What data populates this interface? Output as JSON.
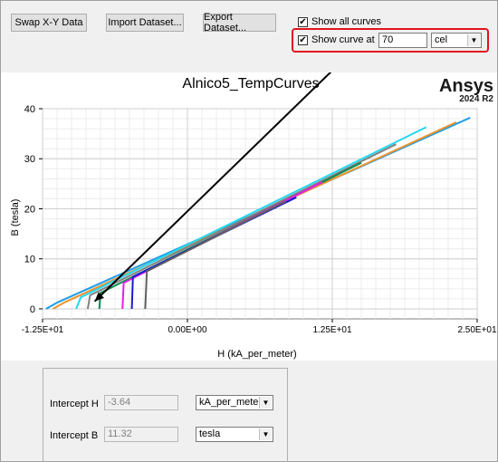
{
  "toolbar": {
    "swap_label": "Swap X-Y Data",
    "import_label": "Import Dataset...",
    "export_label": "Export Dataset..."
  },
  "options": {
    "show_all_curves_label": "Show all curves",
    "show_all_curves_checked": true,
    "show_curve_at_label": "Show curve at",
    "show_curve_at_checked": true,
    "curve_at_value": "70",
    "curve_at_unit": "cel"
  },
  "brand": {
    "name": "Ansys",
    "version": "2024 R2"
  },
  "chart_data": {
    "type": "line",
    "title": "Alnico5_TempCurves",
    "xlabel": "H (kA_per_meter)",
    "ylabel": "B (tesla)",
    "xlim": [
      -12.5,
      25.0
    ],
    "ylim": [
      -2,
      40
    ],
    "x_ticks": [
      -12.5,
      0.0,
      12.5,
      25.0
    ],
    "x_tick_labels": [
      "-1.25E+01",
      "0.00E+00",
      "1.25E+01",
      "2.50E+01"
    ],
    "y_ticks": [
      0,
      10,
      20,
      30,
      40
    ],
    "y_tick_labels": [
      "0",
      "10",
      "20",
      "30",
      "40"
    ],
    "grid": true,
    "series": [
      {
        "color": "#1e9ee8",
        "x": [
          -12.2,
          -11.2,
          24.4
        ],
        "y": [
          0,
          1.3,
          38.2
        ]
      },
      {
        "color": "#f0922a",
        "x": [
          -11.6,
          -10.6,
          23.2
        ],
        "y": [
          0,
          1.3,
          37.3
        ]
      },
      {
        "color": "#22d7f0",
        "x": [
          -9.6,
          -9.2,
          20.6
        ],
        "y": [
          0,
          2.3,
          36.3
        ]
      },
      {
        "color": "#808080",
        "x": [
          -8.6,
          -8.4,
          18.0
        ],
        "y": [
          0,
          2.7,
          32.9
        ]
      },
      {
        "color": "#0a8c50",
        "x": [
          -7.6,
          -7.5,
          15.0
        ],
        "y": [
          0,
          3.2,
          29.2
        ]
      },
      {
        "color": "#e61ee6",
        "x": [
          -5.6,
          -5.5,
          11.6
        ],
        "y": [
          0,
          5.2,
          25.3
        ]
      },
      {
        "color": "#1a1ad2",
        "x": [
          -4.8,
          -4.7,
          9.4
        ],
        "y": [
          0,
          6.4,
          22.3
        ]
      },
      {
        "color": "#606060",
        "x": [
          -3.64,
          -3.5,
          8.5
        ],
        "y": [
          0,
          7.5,
          21.5
        ]
      }
    ]
  },
  "annotation": {
    "arrow_from": {
      "x": 14.0,
      "y": 51.0
    },
    "arrow_to": {
      "x": -8.0,
      "y": 1.5
    }
  },
  "intercepts": {
    "h_label": "Intercept H",
    "h_value": "-3.64",
    "h_unit": "kA_per_meter",
    "b_label": "Intercept B",
    "b_value": "11.32",
    "b_unit": "tesla"
  }
}
